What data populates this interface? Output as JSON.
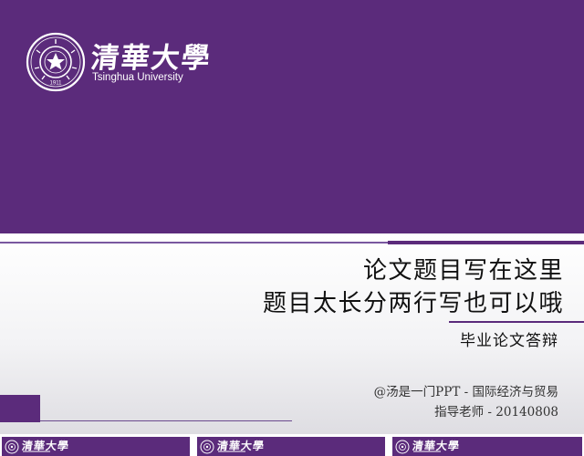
{
  "brand": {
    "name_cn": "清華大學",
    "name_en": "Tsinghua University",
    "seal_year": "1911",
    "colors": {
      "purple": "#5b2b7b",
      "white": "#ffffff"
    }
  },
  "slide": {
    "title_line1": "论文题目写在这里",
    "title_line2": "题目太长分两行写也可以哦",
    "subtitle": "毕业论文答辩",
    "author": "@汤是一门PPT - 国际经济与贸易",
    "advisor": "指导老师 - 20140808"
  },
  "thumbnails": [
    {
      "label": "清華大學",
      "icon": "tsinghua-seal-icon"
    },
    {
      "label": "清華大學",
      "icon": "tsinghua-seal-icon"
    },
    {
      "label": "清華大學",
      "icon": "tsinghua-seal-icon"
    }
  ]
}
